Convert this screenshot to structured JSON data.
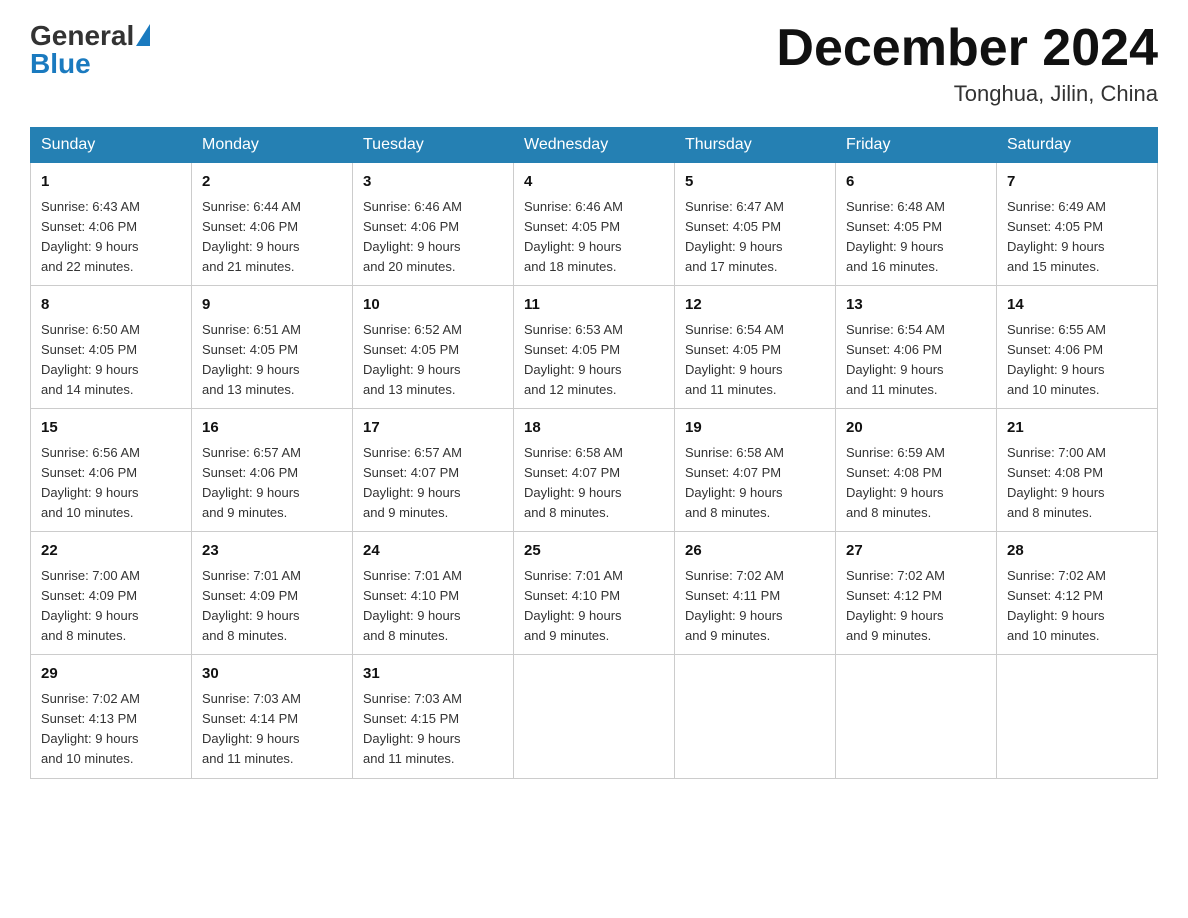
{
  "header": {
    "logo_general": "General",
    "logo_blue": "Blue",
    "month_title": "December 2024",
    "subtitle": "Tonghua, Jilin, China"
  },
  "days_of_week": [
    "Sunday",
    "Monday",
    "Tuesday",
    "Wednesday",
    "Thursday",
    "Friday",
    "Saturday"
  ],
  "weeks": [
    [
      {
        "day": "1",
        "sunrise": "6:43 AM",
        "sunset": "4:06 PM",
        "daylight": "9 hours and 22 minutes."
      },
      {
        "day": "2",
        "sunrise": "6:44 AM",
        "sunset": "4:06 PM",
        "daylight": "9 hours and 21 minutes."
      },
      {
        "day": "3",
        "sunrise": "6:46 AM",
        "sunset": "4:06 PM",
        "daylight": "9 hours and 20 minutes."
      },
      {
        "day": "4",
        "sunrise": "6:46 AM",
        "sunset": "4:05 PM",
        "daylight": "9 hours and 18 minutes."
      },
      {
        "day": "5",
        "sunrise": "6:47 AM",
        "sunset": "4:05 PM",
        "daylight": "9 hours and 17 minutes."
      },
      {
        "day": "6",
        "sunrise": "6:48 AM",
        "sunset": "4:05 PM",
        "daylight": "9 hours and 16 minutes."
      },
      {
        "day": "7",
        "sunrise": "6:49 AM",
        "sunset": "4:05 PM",
        "daylight": "9 hours and 15 minutes."
      }
    ],
    [
      {
        "day": "8",
        "sunrise": "6:50 AM",
        "sunset": "4:05 PM",
        "daylight": "9 hours and 14 minutes."
      },
      {
        "day": "9",
        "sunrise": "6:51 AM",
        "sunset": "4:05 PM",
        "daylight": "9 hours and 13 minutes."
      },
      {
        "day": "10",
        "sunrise": "6:52 AM",
        "sunset": "4:05 PM",
        "daylight": "9 hours and 13 minutes."
      },
      {
        "day": "11",
        "sunrise": "6:53 AM",
        "sunset": "4:05 PM",
        "daylight": "9 hours and 12 minutes."
      },
      {
        "day": "12",
        "sunrise": "6:54 AM",
        "sunset": "4:05 PM",
        "daylight": "9 hours and 11 minutes."
      },
      {
        "day": "13",
        "sunrise": "6:54 AM",
        "sunset": "4:06 PM",
        "daylight": "9 hours and 11 minutes."
      },
      {
        "day": "14",
        "sunrise": "6:55 AM",
        "sunset": "4:06 PM",
        "daylight": "9 hours and 10 minutes."
      }
    ],
    [
      {
        "day": "15",
        "sunrise": "6:56 AM",
        "sunset": "4:06 PM",
        "daylight": "9 hours and 10 minutes."
      },
      {
        "day": "16",
        "sunrise": "6:57 AM",
        "sunset": "4:06 PM",
        "daylight": "9 hours and 9 minutes."
      },
      {
        "day": "17",
        "sunrise": "6:57 AM",
        "sunset": "4:07 PM",
        "daylight": "9 hours and 9 minutes."
      },
      {
        "day": "18",
        "sunrise": "6:58 AM",
        "sunset": "4:07 PM",
        "daylight": "9 hours and 8 minutes."
      },
      {
        "day": "19",
        "sunrise": "6:58 AM",
        "sunset": "4:07 PM",
        "daylight": "9 hours and 8 minutes."
      },
      {
        "day": "20",
        "sunrise": "6:59 AM",
        "sunset": "4:08 PM",
        "daylight": "9 hours and 8 minutes."
      },
      {
        "day": "21",
        "sunrise": "7:00 AM",
        "sunset": "4:08 PM",
        "daylight": "9 hours and 8 minutes."
      }
    ],
    [
      {
        "day": "22",
        "sunrise": "7:00 AM",
        "sunset": "4:09 PM",
        "daylight": "9 hours and 8 minutes."
      },
      {
        "day": "23",
        "sunrise": "7:01 AM",
        "sunset": "4:09 PM",
        "daylight": "9 hours and 8 minutes."
      },
      {
        "day": "24",
        "sunrise": "7:01 AM",
        "sunset": "4:10 PM",
        "daylight": "9 hours and 8 minutes."
      },
      {
        "day": "25",
        "sunrise": "7:01 AM",
        "sunset": "4:10 PM",
        "daylight": "9 hours and 9 minutes."
      },
      {
        "day": "26",
        "sunrise": "7:02 AM",
        "sunset": "4:11 PM",
        "daylight": "9 hours and 9 minutes."
      },
      {
        "day": "27",
        "sunrise": "7:02 AM",
        "sunset": "4:12 PM",
        "daylight": "9 hours and 9 minutes."
      },
      {
        "day": "28",
        "sunrise": "7:02 AM",
        "sunset": "4:12 PM",
        "daylight": "9 hours and 10 minutes."
      }
    ],
    [
      {
        "day": "29",
        "sunrise": "7:02 AM",
        "sunset": "4:13 PM",
        "daylight": "9 hours and 10 minutes."
      },
      {
        "day": "30",
        "sunrise": "7:03 AM",
        "sunset": "4:14 PM",
        "daylight": "9 hours and 11 minutes."
      },
      {
        "day": "31",
        "sunrise": "7:03 AM",
        "sunset": "4:15 PM",
        "daylight": "9 hours and 11 minutes."
      },
      null,
      null,
      null,
      null
    ]
  ],
  "labels": {
    "sunrise": "Sunrise:",
    "sunset": "Sunset:",
    "daylight": "Daylight:"
  }
}
